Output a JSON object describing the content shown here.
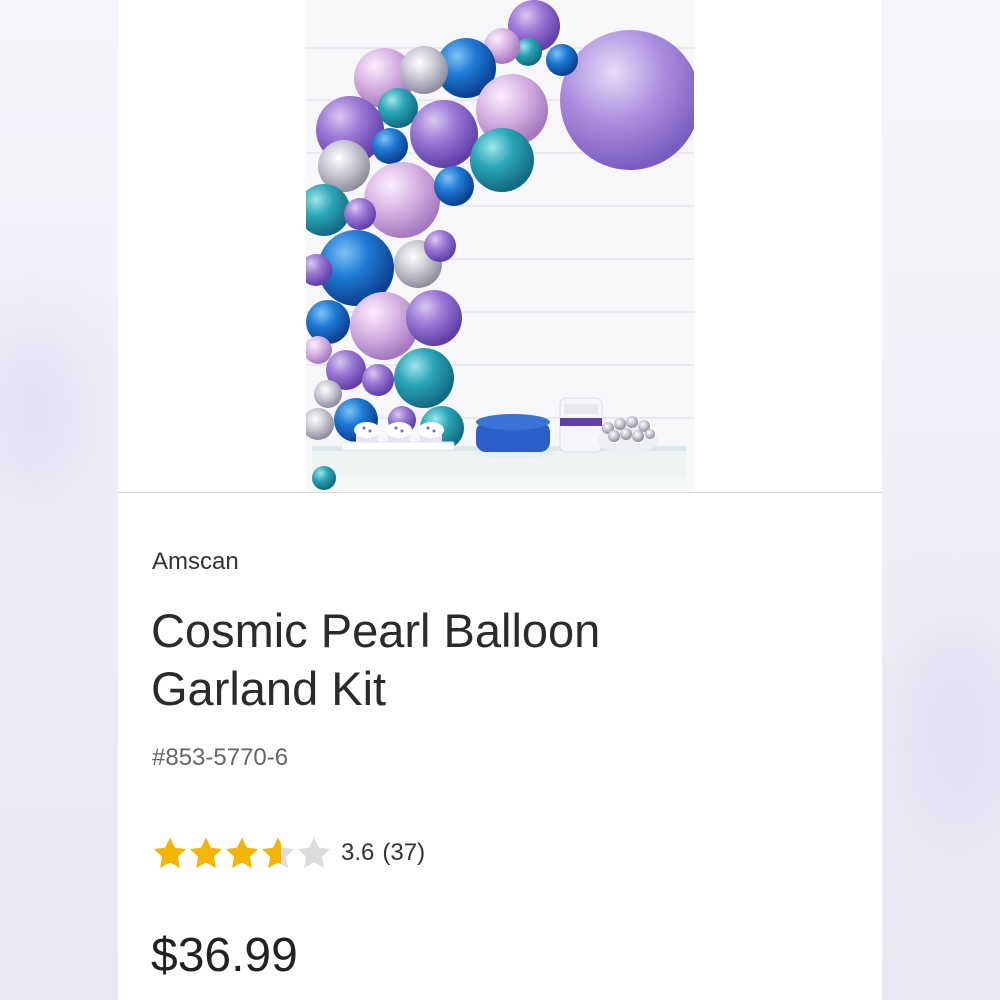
{
  "product": {
    "brand": "Amscan",
    "title": "Cosmic Pearl Balloon Garland Kit",
    "sku": "#853-5770-6",
    "rating": 3.6,
    "rating_display": "3.6",
    "review_count": "(37)",
    "price": "$36.99",
    "image_icon": "balloon-garland-product-photo"
  },
  "colors": {
    "star_filled": "#f4b400",
    "star_empty": "#dcdcdc",
    "balloon_purple": "#8a63c9",
    "balloon_blue": "#1f78d1",
    "balloon_teal": "#2aa6b8",
    "balloon_pink": "#d4b0df",
    "balloon_silver": "#d9d9e3"
  }
}
